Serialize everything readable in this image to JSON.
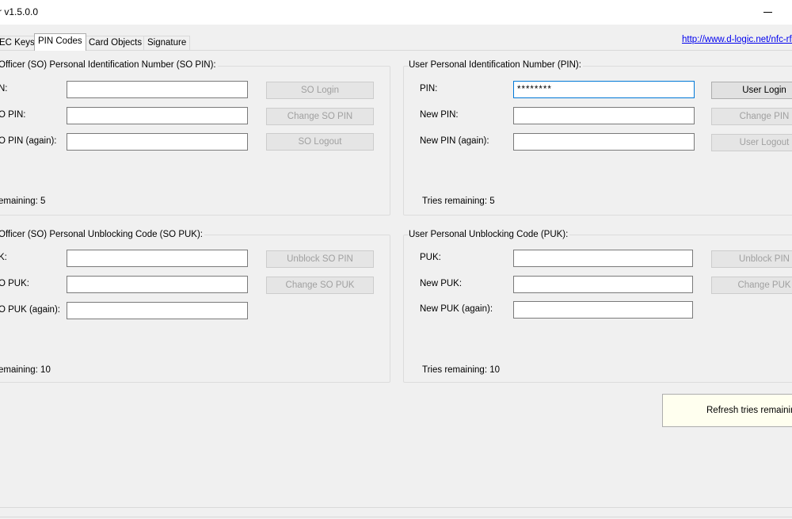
{
  "window": {
    "title": "r v1.5.0.0"
  },
  "tabs": [
    "EC Keys",
    "PIN Codes",
    "Card Objects",
    "Signature"
  ],
  "link_text": "http://www.d-logic.net/nfc-rfi",
  "so_pin": {
    "legend": "Officer (SO) Personal Identification Number (SO PIN):",
    "labels": [
      "N:",
      "O PIN:",
      "O PIN (again):"
    ],
    "buttons": [
      "SO Login",
      "Change SO PIN",
      "SO Logout"
    ],
    "tries": "emaining: 5"
  },
  "user_pin": {
    "legend": "User Personal Identification Number (PIN):",
    "labels": [
      "PIN:",
      "New PIN:",
      "New PIN (again):"
    ],
    "pin_value": "********",
    "buttons": [
      "User Login",
      "Change PIN",
      "User Logout"
    ],
    "tries": "Tries remaining: 5"
  },
  "so_puk": {
    "legend": "Officer (SO) Personal Unblocking Code (SO PUK):",
    "labels": [
      "K:",
      "O PUK:",
      "O PUK (again):"
    ],
    "buttons": [
      "Unblock SO PIN",
      "Change SO PUK"
    ],
    "tries": "emaining: 10"
  },
  "user_puk": {
    "legend": "User Personal Unblocking Code (PUK):",
    "labels": [
      "PUK:",
      "New PUK:",
      "New PUK (again):"
    ],
    "buttons": [
      "Unblock PIN",
      "Change PUK"
    ],
    "tries": "Tries remaining: 10"
  },
  "refresh_button": "Refresh tries remaining"
}
